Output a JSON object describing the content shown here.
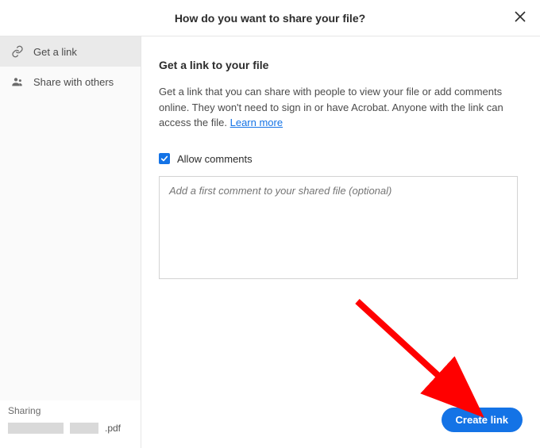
{
  "header": {
    "title": "How do you want to share your file?"
  },
  "sidebar": {
    "items": [
      {
        "label": "Get a link"
      },
      {
        "label": "Share with others"
      }
    ],
    "sharing_label": "Sharing",
    "sharing_ext": ".pdf"
  },
  "main": {
    "section_title": "Get a link to your file",
    "description": "Get a link that you can share with people to view your file or add comments online. They won't need to sign in or have Acrobat. Anyone with the link can access the file. ",
    "learn_more": "Learn more",
    "allow_comments_label": "Allow comments",
    "allow_comments_checked": true,
    "comment_placeholder": "Add a first comment to your shared file (optional)",
    "create_button": "Create link"
  }
}
